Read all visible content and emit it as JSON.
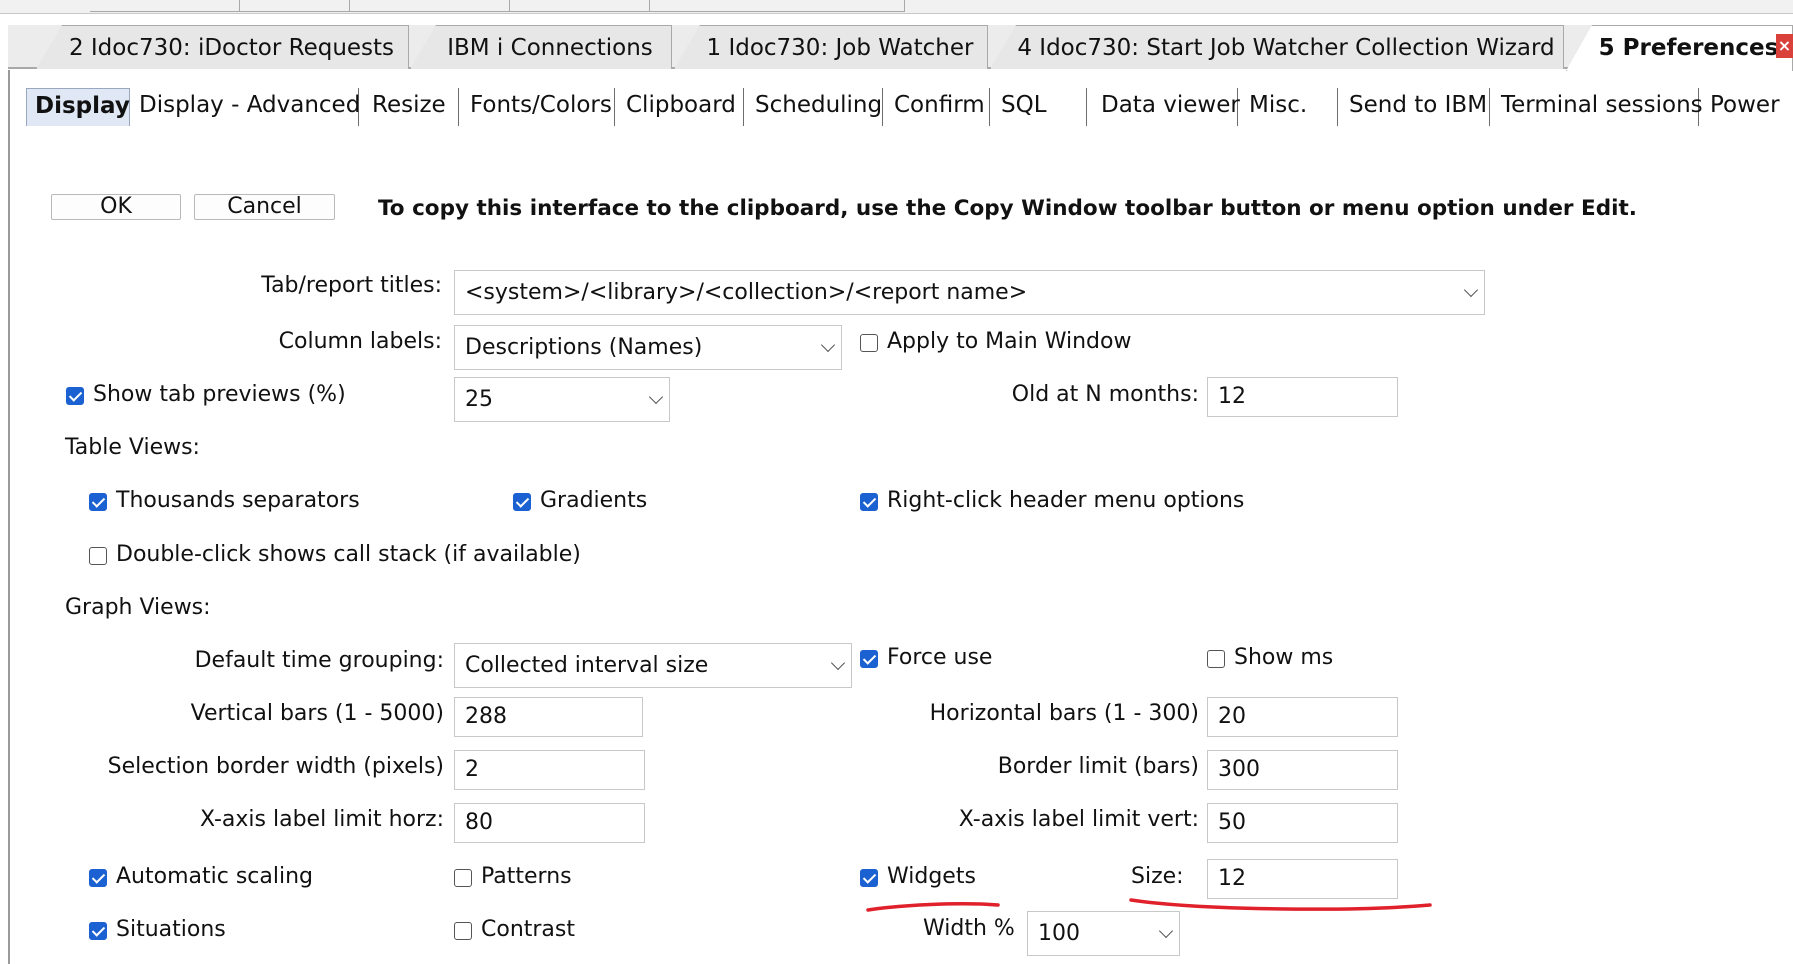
{
  "doc_tabs": [
    {
      "label": "2 Idoc730:  iDoctor Requests"
    },
    {
      "label": "IBM i Connections"
    },
    {
      "label": "1 Idoc730:  Job Watcher"
    },
    {
      "label": "4 Idoc730: Start Job Watcher Collection Wizard"
    },
    {
      "label": "5 Preferences",
      "active": true
    }
  ],
  "close_glyph": "×",
  "pref_tabs": [
    {
      "label": "Display",
      "active": true
    },
    {
      "label": "Display - Advanced"
    },
    {
      "label": "Resize"
    },
    {
      "label": "Fonts/Colors"
    },
    {
      "label": "Clipboard"
    },
    {
      "label": "Scheduling"
    },
    {
      "label": "Confirm"
    },
    {
      "label": "SQL"
    },
    {
      "label": "Data viewer"
    },
    {
      "label": "Misc."
    },
    {
      "label": "Send to IBM"
    },
    {
      "label": "Terminal sessions"
    },
    {
      "label": "Power"
    }
  ],
  "buttons": {
    "ok": "OK",
    "cancel": "Cancel"
  },
  "hint": "To copy this interface to the clipboard, use the Copy Window toolbar button or menu option under Edit.",
  "general": {
    "tab_report_titles_label": "Tab/report titles:",
    "tab_report_titles_value": "<system>/<library>/<collection>/<report name>",
    "column_labels_label": "Column labels:",
    "column_labels_value": "Descriptions (Names)",
    "apply_main_window_label": "Apply to Main Window",
    "apply_main_window_checked": false,
    "show_tab_previews_label": "Show tab previews (%)",
    "show_tab_previews_checked": true,
    "show_tab_previews_value": "25",
    "old_at_n_months_label": "Old at N months:",
    "old_at_n_months_value": "12"
  },
  "table_views": {
    "heading": "Table Views:",
    "thousands_separators": {
      "label": "Thousands separators",
      "checked": true
    },
    "gradients": {
      "label": "Gradients",
      "checked": true
    },
    "right_click_header": {
      "label": "Right-click header menu options",
      "checked": true
    },
    "double_click_call_stack": {
      "label": "Double-click shows call stack (if available)",
      "checked": false
    }
  },
  "graph_views": {
    "heading": "Graph Views:",
    "default_time_grouping_label": "Default time grouping:",
    "default_time_grouping_value": "Collected interval size",
    "force_use": {
      "label": "Force use",
      "checked": true
    },
    "show_ms": {
      "label": "Show ms",
      "checked": false
    },
    "vertical_bars_label": "Vertical bars (1 - 5000)",
    "vertical_bars_value": "288",
    "horizontal_bars_label": "Horizontal bars (1 - 300)",
    "horizontal_bars_value": "20",
    "selection_border_label": "Selection border width (pixels)",
    "selection_border_value": "2",
    "border_limit_label": "Border limit (bars)",
    "border_limit_value": "300",
    "x_axis_horz_label": "X-axis label limit horz:",
    "x_axis_horz_value": "80",
    "x_axis_vert_label": "X-axis label limit vert:",
    "x_axis_vert_value": "50",
    "automatic_scaling": {
      "label": "Automatic scaling",
      "checked": true
    },
    "patterns": {
      "label": "Patterns",
      "checked": false
    },
    "widgets": {
      "label": "Widgets",
      "checked": true
    },
    "size_label": "Size:",
    "size_value": "12",
    "situations": {
      "label": "Situations",
      "checked": true
    },
    "contrast": {
      "label": "Contrast",
      "checked": false
    },
    "width_pct_label": "Width %",
    "width_pct_value": "100"
  },
  "colors": {
    "accent_checkbox": "#1b61d1",
    "annotation_red": "#e0202a",
    "active_pref_tab_bg": "#dfe8f4"
  }
}
